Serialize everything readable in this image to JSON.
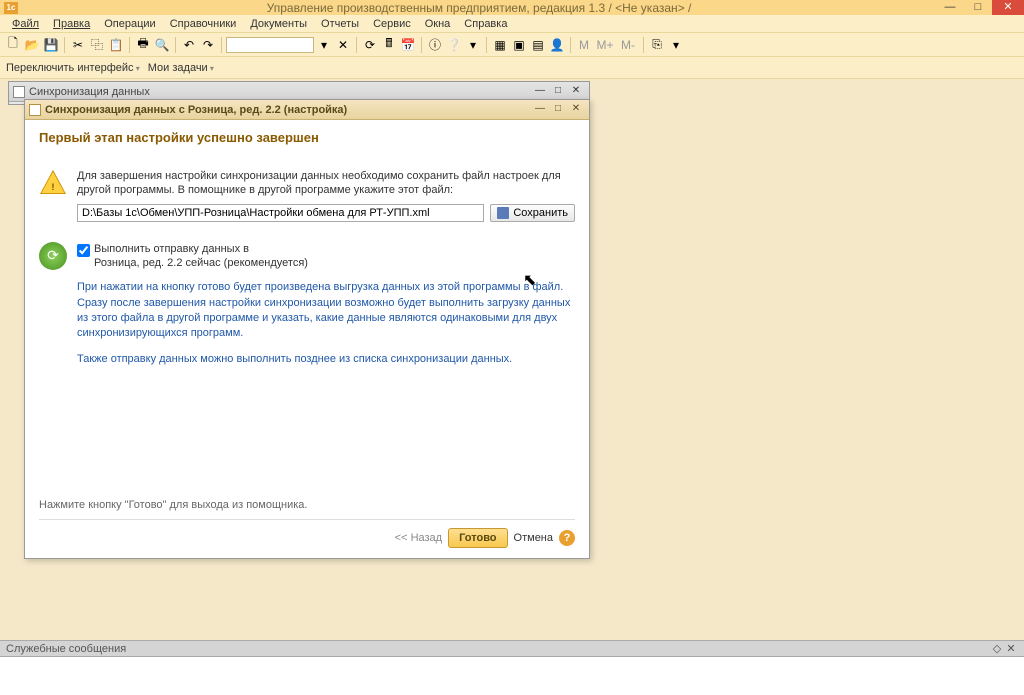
{
  "app": {
    "title": "Управление производственным предприятием, редакция 1.3 / <Не указан> /"
  },
  "menu": {
    "file": "Файл",
    "edit": "Правка",
    "ops": "Операции",
    "refs": "Справочники",
    "docs": "Документы",
    "reports": "Отчеты",
    "service": "Сервис",
    "windows": "Окна",
    "help": "Справка"
  },
  "sub": {
    "switch": "Переключить интерфейс",
    "tasks": "Мои задачи"
  },
  "toolbar": {
    "m": "M",
    "mplus": "M+",
    "mminus": "M-"
  },
  "panel1": {
    "title": "Синхронизация данных"
  },
  "panel2": {
    "title": "Синхронизация данных с Розница, ред. 2.2 (настройка)"
  },
  "heading": "Первый этап настройки успешно завершен",
  "desc": "Для завершения настройки синхронизации данных необходимо сохранить файл настроек для другой программы. В помощнике в другой программе укажите этот файл:",
  "path": "D:\\Базы 1с\\Обмен\\УПП-Розница\\Настройки обмена для РТ-УПП.xml",
  "save": "Сохранить",
  "chk_line1": "Выполнить отправку данных в",
  "chk_line2": "Розница, ред. 2.2 сейчас (рекомендуется)",
  "blue1": "При нажатии на кнопку готово будет произведена выгрузка данных из этой программы в файл. Сразу после завершения настройки синхронизации возможно будет выполнить загрузку данных из этого файла в другой программе и указать, какие данные являются одинаковыми для двух синхронизирующихся программ.",
  "blue2": "Также отправку данных можно выполнить позднее из списка синхронизации данных.",
  "hint": "Нажмите кнопку \"Готово\" для выхода из помощника.",
  "footer": {
    "back": "<< Назад",
    "ready": "Готово",
    "cancel": "Отмена",
    "help": "?"
  },
  "status": {
    "label": "Служебные сообщения"
  }
}
